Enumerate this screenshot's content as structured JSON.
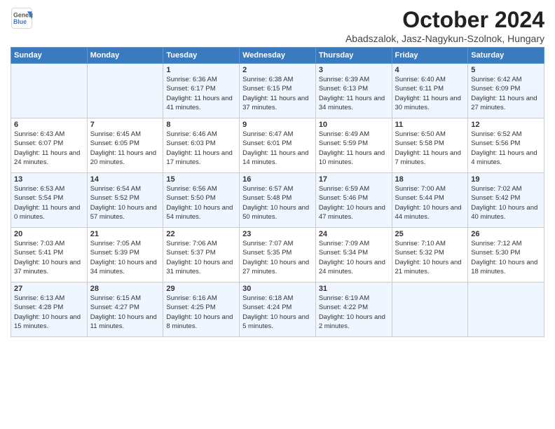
{
  "header": {
    "logo_line1": "General",
    "logo_line2": "Blue",
    "month": "October 2024",
    "location": "Abadszalok, Jasz-Nagykun-Szolnok, Hungary"
  },
  "days_of_week": [
    "Sunday",
    "Monday",
    "Tuesday",
    "Wednesday",
    "Thursday",
    "Friday",
    "Saturday"
  ],
  "weeks": [
    [
      {
        "day": "",
        "info": ""
      },
      {
        "day": "",
        "info": ""
      },
      {
        "day": "1",
        "info": "Sunrise: 6:36 AM\nSunset: 6:17 PM\nDaylight: 11 hours and 41 minutes."
      },
      {
        "day": "2",
        "info": "Sunrise: 6:38 AM\nSunset: 6:15 PM\nDaylight: 11 hours and 37 minutes."
      },
      {
        "day": "3",
        "info": "Sunrise: 6:39 AM\nSunset: 6:13 PM\nDaylight: 11 hours and 34 minutes."
      },
      {
        "day": "4",
        "info": "Sunrise: 6:40 AM\nSunset: 6:11 PM\nDaylight: 11 hours and 30 minutes."
      },
      {
        "day": "5",
        "info": "Sunrise: 6:42 AM\nSunset: 6:09 PM\nDaylight: 11 hours and 27 minutes."
      }
    ],
    [
      {
        "day": "6",
        "info": "Sunrise: 6:43 AM\nSunset: 6:07 PM\nDaylight: 11 hours and 24 minutes."
      },
      {
        "day": "7",
        "info": "Sunrise: 6:45 AM\nSunset: 6:05 PM\nDaylight: 11 hours and 20 minutes."
      },
      {
        "day": "8",
        "info": "Sunrise: 6:46 AM\nSunset: 6:03 PM\nDaylight: 11 hours and 17 minutes."
      },
      {
        "day": "9",
        "info": "Sunrise: 6:47 AM\nSunset: 6:01 PM\nDaylight: 11 hours and 14 minutes."
      },
      {
        "day": "10",
        "info": "Sunrise: 6:49 AM\nSunset: 5:59 PM\nDaylight: 11 hours and 10 minutes."
      },
      {
        "day": "11",
        "info": "Sunrise: 6:50 AM\nSunset: 5:58 PM\nDaylight: 11 hours and 7 minutes."
      },
      {
        "day": "12",
        "info": "Sunrise: 6:52 AM\nSunset: 5:56 PM\nDaylight: 11 hours and 4 minutes."
      }
    ],
    [
      {
        "day": "13",
        "info": "Sunrise: 6:53 AM\nSunset: 5:54 PM\nDaylight: 11 hours and 0 minutes."
      },
      {
        "day": "14",
        "info": "Sunrise: 6:54 AM\nSunset: 5:52 PM\nDaylight: 10 hours and 57 minutes."
      },
      {
        "day": "15",
        "info": "Sunrise: 6:56 AM\nSunset: 5:50 PM\nDaylight: 10 hours and 54 minutes."
      },
      {
        "day": "16",
        "info": "Sunrise: 6:57 AM\nSunset: 5:48 PM\nDaylight: 10 hours and 50 minutes."
      },
      {
        "day": "17",
        "info": "Sunrise: 6:59 AM\nSunset: 5:46 PM\nDaylight: 10 hours and 47 minutes."
      },
      {
        "day": "18",
        "info": "Sunrise: 7:00 AM\nSunset: 5:44 PM\nDaylight: 10 hours and 44 minutes."
      },
      {
        "day": "19",
        "info": "Sunrise: 7:02 AM\nSunset: 5:42 PM\nDaylight: 10 hours and 40 minutes."
      }
    ],
    [
      {
        "day": "20",
        "info": "Sunrise: 7:03 AM\nSunset: 5:41 PM\nDaylight: 10 hours and 37 minutes."
      },
      {
        "day": "21",
        "info": "Sunrise: 7:05 AM\nSunset: 5:39 PM\nDaylight: 10 hours and 34 minutes."
      },
      {
        "day": "22",
        "info": "Sunrise: 7:06 AM\nSunset: 5:37 PM\nDaylight: 10 hours and 31 minutes."
      },
      {
        "day": "23",
        "info": "Sunrise: 7:07 AM\nSunset: 5:35 PM\nDaylight: 10 hours and 27 minutes."
      },
      {
        "day": "24",
        "info": "Sunrise: 7:09 AM\nSunset: 5:34 PM\nDaylight: 10 hours and 24 minutes."
      },
      {
        "day": "25",
        "info": "Sunrise: 7:10 AM\nSunset: 5:32 PM\nDaylight: 10 hours and 21 minutes."
      },
      {
        "day": "26",
        "info": "Sunrise: 7:12 AM\nSunset: 5:30 PM\nDaylight: 10 hours and 18 minutes."
      }
    ],
    [
      {
        "day": "27",
        "info": "Sunrise: 6:13 AM\nSunset: 4:28 PM\nDaylight: 10 hours and 15 minutes."
      },
      {
        "day": "28",
        "info": "Sunrise: 6:15 AM\nSunset: 4:27 PM\nDaylight: 10 hours and 11 minutes."
      },
      {
        "day": "29",
        "info": "Sunrise: 6:16 AM\nSunset: 4:25 PM\nDaylight: 10 hours and 8 minutes."
      },
      {
        "day": "30",
        "info": "Sunrise: 6:18 AM\nSunset: 4:24 PM\nDaylight: 10 hours and 5 minutes."
      },
      {
        "day": "31",
        "info": "Sunrise: 6:19 AM\nSunset: 4:22 PM\nDaylight: 10 hours and 2 minutes."
      },
      {
        "day": "",
        "info": ""
      },
      {
        "day": "",
        "info": ""
      }
    ]
  ]
}
